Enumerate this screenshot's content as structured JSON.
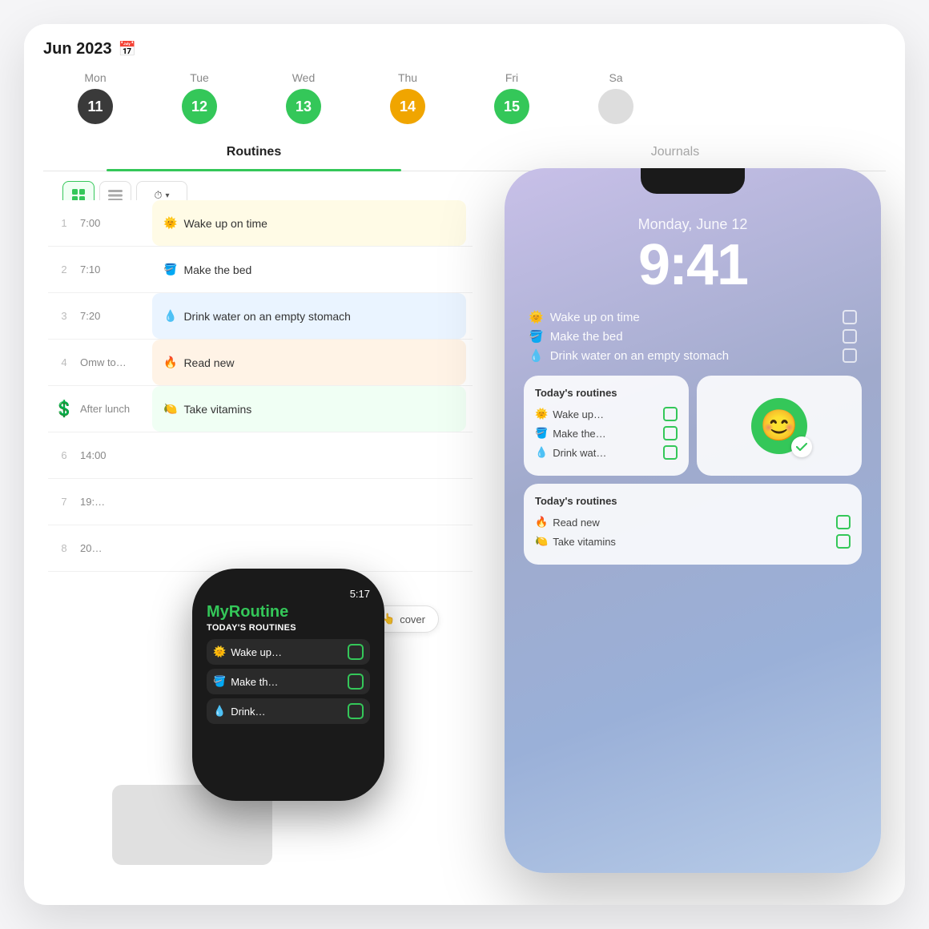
{
  "header": {
    "month_year": "Jun 2023",
    "calendar_icon": "📅"
  },
  "days": [
    {
      "label": "Mon",
      "number": "11",
      "style": "selected"
    },
    {
      "label": "Tue",
      "number": "12",
      "style": "green"
    },
    {
      "label": "Wed",
      "number": "13",
      "style": "green"
    },
    {
      "label": "Thu",
      "number": "14",
      "style": "yellow"
    },
    {
      "label": "Fri",
      "number": "15",
      "style": "green"
    },
    {
      "label": "Sa",
      "number": "",
      "style": "none"
    }
  ],
  "tabs": [
    {
      "id": "routines",
      "label": "Routines",
      "active": true
    },
    {
      "id": "journals",
      "label": "Journals",
      "active": false
    }
  ],
  "toolbar": {
    "view1_icon": "⊞",
    "view2_icon": "⊟",
    "filter_label": "⏱",
    "filter_arrow": "▾"
  },
  "routines": [
    {
      "num": "1",
      "time": "7:00",
      "emoji": "🌞",
      "text": "Wake up on time",
      "bg": "yellow-bg"
    },
    {
      "num": "2",
      "time": "7:10",
      "emoji": "🪣",
      "text": "Make the bed",
      "bg": "no-bg"
    },
    {
      "num": "3",
      "time": "7:20",
      "emoji": "💧",
      "text": "Drink water on an empty stomach",
      "bg": "blue-bg"
    },
    {
      "num": "4",
      "time": "Omw to…",
      "emoji": "🔥",
      "text": "Read new",
      "bg": "orange-bg"
    },
    {
      "num": "5_icon",
      "time": "After lunch",
      "emoji": "🍋",
      "text": "Take vitamins",
      "bg": "green-bg"
    },
    {
      "num": "6",
      "time": "14:00",
      "emoji": "",
      "text": "",
      "bg": "no-bg"
    },
    {
      "num": "7",
      "time": "19:…",
      "emoji": "",
      "text": "",
      "bg": "no-bg"
    },
    {
      "num": "8",
      "time": "20…",
      "emoji": "",
      "text": "",
      "bg": "no-bg"
    }
  ],
  "phone": {
    "date": "Monday, June 12",
    "time": "9:41",
    "lock_routines": [
      {
        "emoji": "🌞",
        "text": "Wake up on time"
      },
      {
        "emoji": "🪣",
        "text": "Make the bed"
      },
      {
        "emoji": "💧",
        "text": "Drink water on an empty stomach"
      }
    ],
    "widget1": {
      "title": "Today's routines",
      "items": [
        {
          "emoji": "🌞",
          "text": "Wake up…"
        },
        {
          "emoji": "🪣",
          "text": "Make the…"
        },
        {
          "emoji": "💧",
          "text": "Drink wat…"
        }
      ]
    },
    "widget2_icon": "😊",
    "widget3": {
      "title": "Today's routines",
      "items": [
        {
          "emoji": "🔥",
          "text": "Read new"
        },
        {
          "emoji": "🍋",
          "text": "Take vitamins"
        }
      ]
    }
  },
  "watch": {
    "time": "5:17",
    "app_name": "MyRoutine",
    "subtitle": "TODAY'S ROUTINES",
    "items": [
      {
        "emoji": "🌞",
        "text": "Wake up…"
      },
      {
        "emoji": "🪣",
        "text": "Make th…"
      },
      {
        "emoji": "💧",
        "text": "Drink…"
      }
    ]
  },
  "discover_btn": "cover"
}
